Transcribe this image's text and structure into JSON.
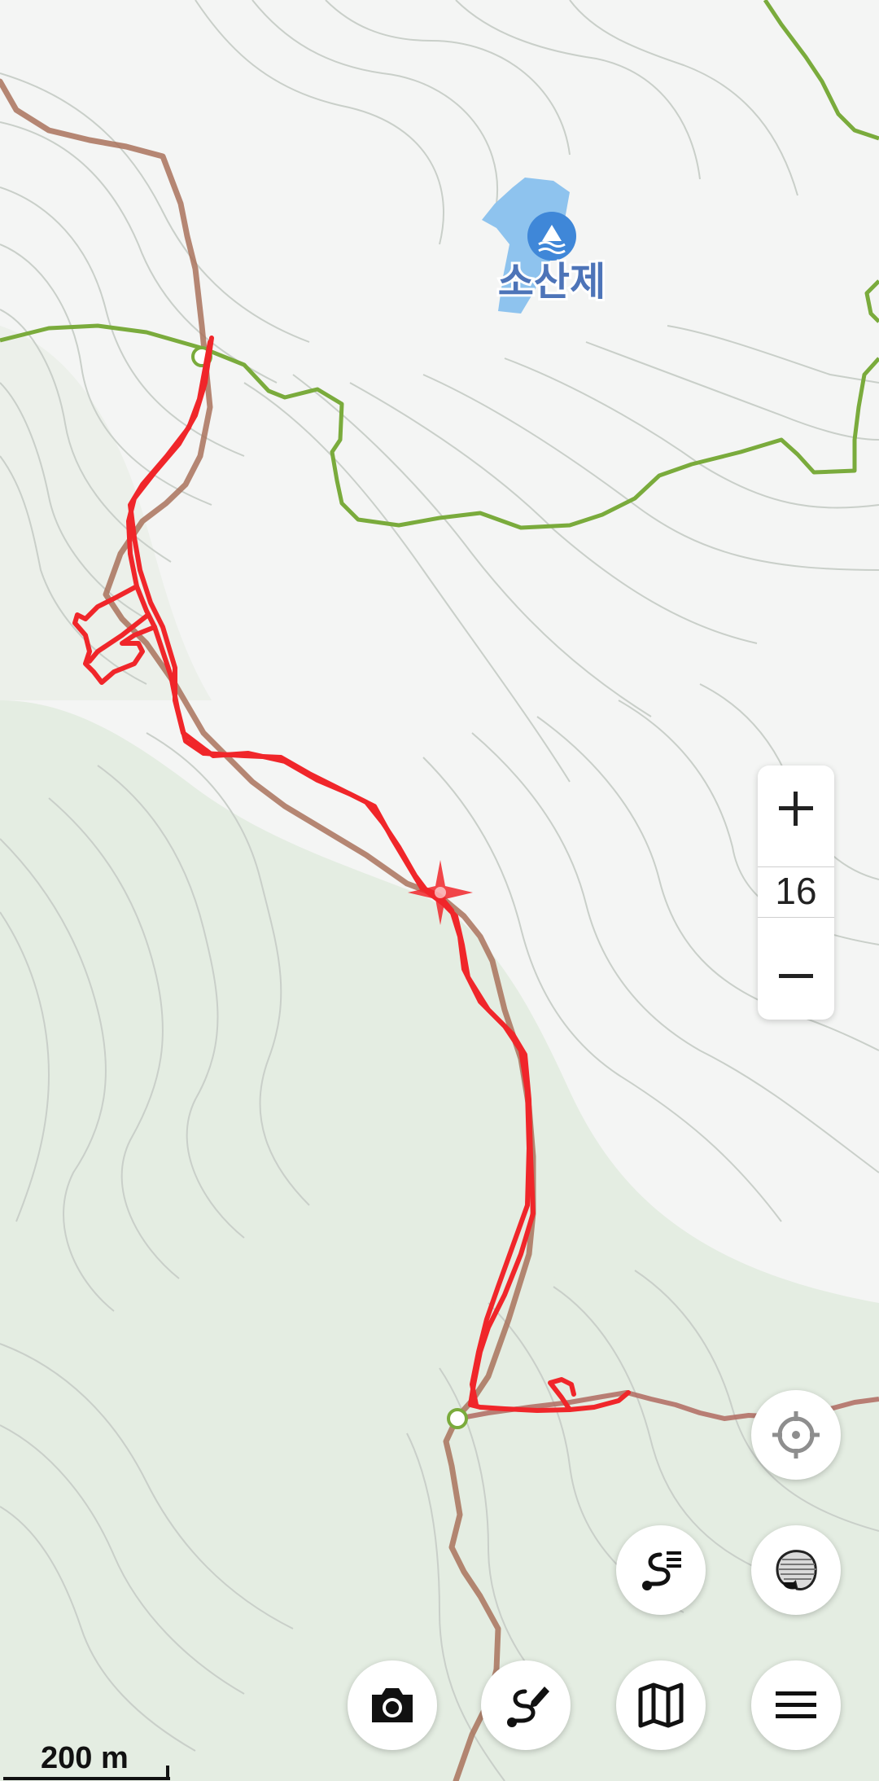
{
  "map": {
    "type": "topographic-map",
    "lake_label": "소산제",
    "colors": {
      "background": "#f4f5f4",
      "contour": "#c7cdc7",
      "forest": "#dfe9dc",
      "trail": "#a9725c",
      "boundary": "#7aab3c",
      "track": "#f0262a",
      "lake": "#8ec3ee",
      "lake_icon": "#3f87d8"
    }
  },
  "zoom": {
    "level": "16",
    "in_icon": "plus-icon",
    "out_icon": "minus-icon"
  },
  "scale": {
    "label": "200 m"
  },
  "controls": {
    "locate": "crosshair-icon",
    "track_list": "route-list-icon",
    "layers": "layers-icon",
    "camera": "camera-icon",
    "route_edit": "route-edit-icon",
    "map_select": "folded-map-icon",
    "menu": "hamburger-menu-icon"
  }
}
